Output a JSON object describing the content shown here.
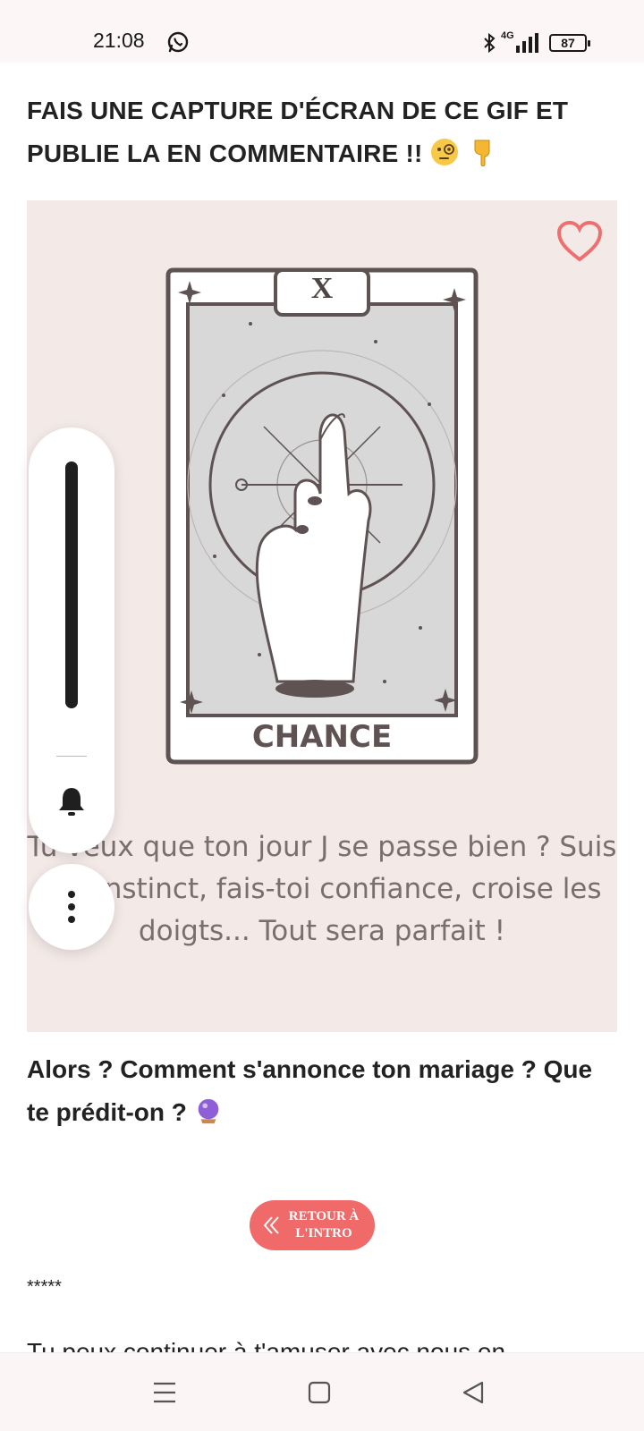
{
  "status_bar": {
    "time": "21:08",
    "network": "4G",
    "battery": "87"
  },
  "post": {
    "headline": "FAIS UNE CAPTURE D'ÉCRAN DE CE GIF ET PUBLIE LA EN COMMENTAIRE !!",
    "headline_emojis": [
      "monocle-face",
      "pointing-down"
    ],
    "gif": {
      "card_number": "X",
      "card_title": "CHANCE",
      "caption": "Tu veux que ton jour J se passe bien ? Suis ton instinct, fais-toi confiance, croise les doigts... Tout sera parfait !"
    },
    "question": "Alors ? Comment s'annonce ton mariage ? Que te prédit-on ?",
    "question_emoji": "crystal-ball",
    "retour_button": {
      "line1": "RETOUR À",
      "line2": "L'INTRO"
    },
    "separator": "*****",
    "cut_text": "Tu peux continuer à t'amuser avec nous en"
  },
  "colors": {
    "accent": "#f06a6a",
    "gif_background": "#f3e9e7",
    "heart": "#ee6f70"
  }
}
